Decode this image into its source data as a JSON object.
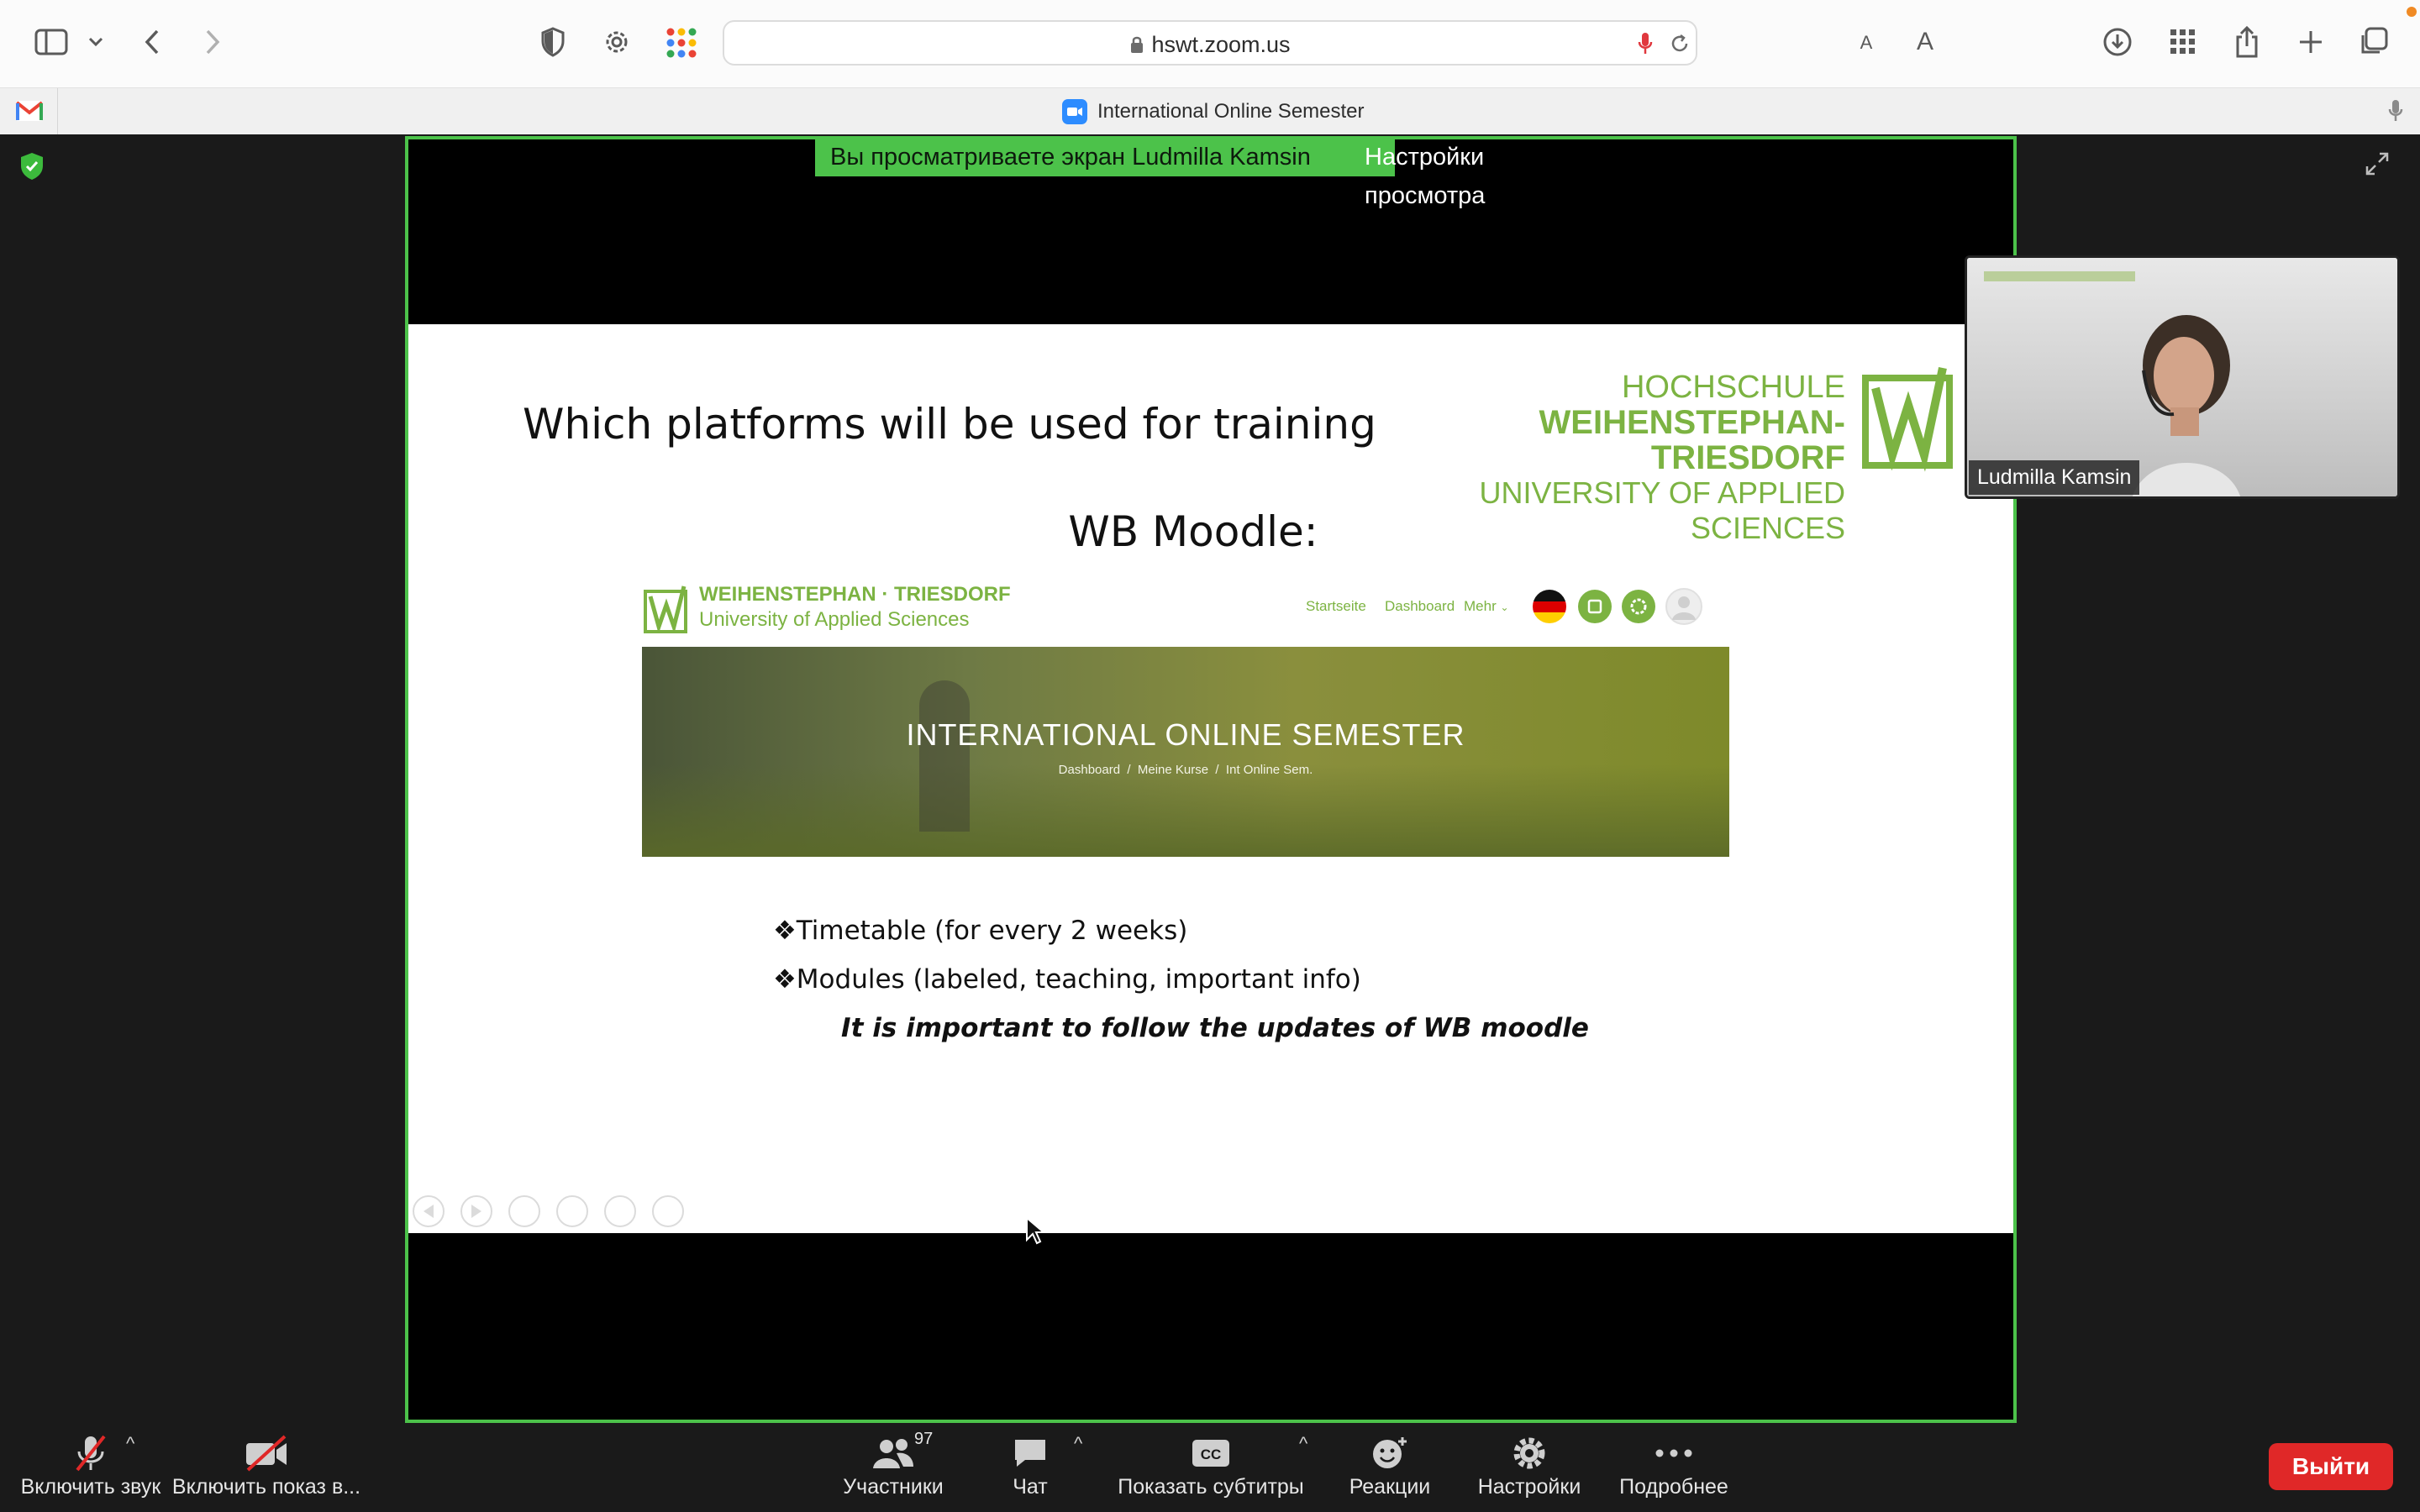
{
  "browser": {
    "url": "hswt.zoom.us",
    "tab_title": "International Online Semester",
    "font_small": "A",
    "font_large": "A"
  },
  "zoom": {
    "share_banner": "Вы просматриваете экран Ludmilla Kamsin",
    "view_settings": "Настройки просмотра",
    "participant_name": "Ludmilla Kamsin",
    "participants_count": "97"
  },
  "slide": {
    "title": "Which platforms will be used for training",
    "logo_line1": "HOCHSCHULE",
    "logo_line2": "WEIHENSTEPHAN-TRIESDORF",
    "logo_line3": "UNIVERSITY OF APPLIED SCIENCES",
    "subtitle": "WB Moodle:",
    "moodle": {
      "brand_line1": "WEIHENSTEPHAN · TRIESDORF",
      "brand_line2": "University of Applied Sciences",
      "nav": [
        "Startseite",
        "Dashboard",
        "Mehr"
      ],
      "hero_title": "INTERNATIONAL ONLINE SEMESTER",
      "breadcrumb": "Dashboard  /  Meine Kurse  /  Int Online Sem."
    },
    "bullets": [
      "Timetable (for every 2 weeks)",
      "Modules (labeled, teaching, important info)"
    ],
    "bullet_symbol": "❖",
    "note": "It is important to follow the updates of WB moodle"
  },
  "controls": {
    "audio": "Включить звук",
    "video": "Включить показ в...",
    "participants": "Участники",
    "chat": "Чат",
    "captions": "Показать субтитры",
    "reactions": "Реакции",
    "settings": "Настройки",
    "more": "Подробнее",
    "exit": "Выйти"
  },
  "colors": {
    "share_border": "#4cc24a",
    "brand_green": "#7cb342",
    "exit_red": "#e02828"
  }
}
